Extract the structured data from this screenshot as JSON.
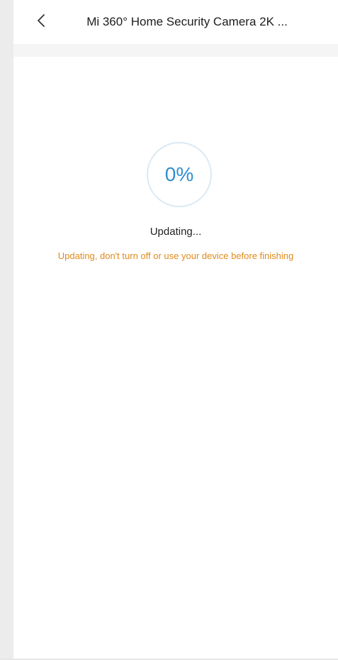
{
  "header": {
    "back_icon": "chevron-left-icon",
    "title": "Mi 360° Home Security Camera 2K ..."
  },
  "update": {
    "progress_percent": 0,
    "progress_label": "0%",
    "status": "Updating...",
    "warning": "Updating, don't turn off or use your device before finishing"
  },
  "colors": {
    "accent": "#2f8fd0",
    "ring": "#dbe9f3",
    "warning": "#e08a1e"
  }
}
